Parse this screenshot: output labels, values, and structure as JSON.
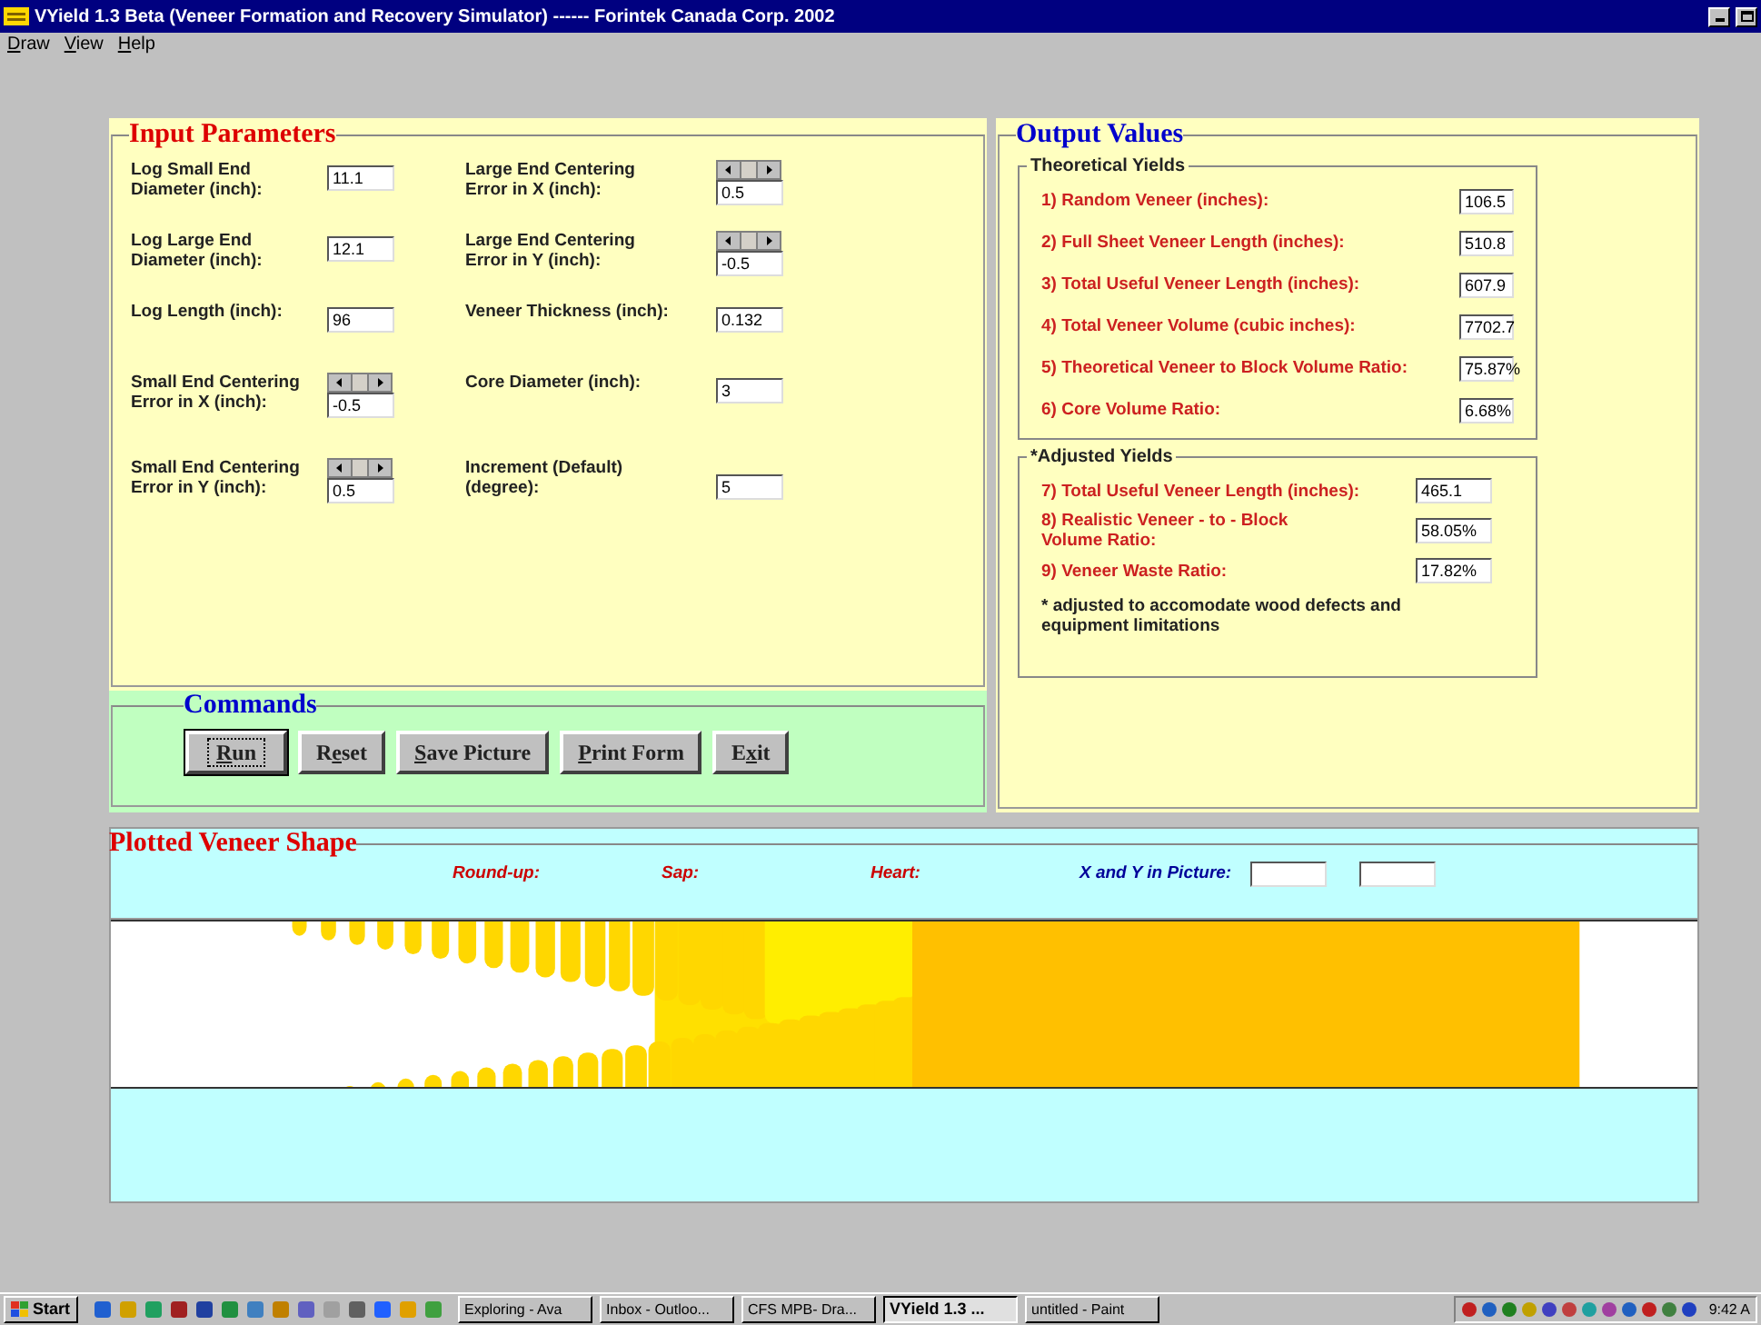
{
  "window": {
    "title": "VYield 1.3 Beta (Veneer Formation and Recovery Simulator) ------ Forintek Canada Corp. 2002"
  },
  "menu": [
    {
      "key": "D",
      "rest": "raw"
    },
    {
      "key": "V",
      "rest": "iew"
    },
    {
      "key": "H",
      "rest": "elp"
    }
  ],
  "input_parameters": {
    "title": "Input Parameters",
    "fields": [
      {
        "label": "Log Small End Diameter (inch):",
        "value": "11.1",
        "kind": "text"
      },
      {
        "label": "Large End Centering Error in X (inch):",
        "value": "0.5",
        "kind": "spin"
      },
      {
        "label": "Log Large End Diameter (inch):",
        "value": "12.1",
        "kind": "text"
      },
      {
        "label": "Large End Centering Error in Y (inch):",
        "value": "-0.5",
        "kind": "spin"
      },
      {
        "label": "Log Length (inch):",
        "value": "96",
        "kind": "text"
      },
      {
        "label": "Veneer Thickness (inch):",
        "value": "0.132",
        "kind": "text"
      },
      {
        "label": "Small End Centering Error in X (inch):",
        "value": "-0.5",
        "kind": "spin"
      },
      {
        "label": "Core Diameter (inch):",
        "value": "3",
        "kind": "text"
      },
      {
        "label": "Small End Centering Error in Y (inch):",
        "value": "0.5",
        "kind": "spin"
      },
      {
        "label": "Increment (Default) (degree):",
        "value": "5",
        "kind": "text"
      }
    ]
  },
  "commands": {
    "title": "Commands",
    "buttons": [
      {
        "key": "R",
        "post": "un",
        "focused": true
      },
      {
        "pre": "R",
        "key": "e",
        "post": "set",
        "focused": false
      },
      {
        "key": "S",
        "post": "ave Picture",
        "focused": false
      },
      {
        "key": "P",
        "post": "rint Form",
        "focused": false
      },
      {
        "pre": "E",
        "key": "x",
        "post": "it",
        "focused": false
      }
    ]
  },
  "output_values": {
    "title": "Output Values",
    "theoretical": {
      "title": "Theoretical Yields",
      "rows": [
        {
          "label": "1) Random Veneer (inches):",
          "value": "106.5"
        },
        {
          "label": "2) Full Sheet Veneer Length (inches):",
          "value": "510.8"
        },
        {
          "label": "3) Total Useful Veneer Length (inches):",
          "value": "607.9"
        },
        {
          "label": "4) Total Veneer Volume (cubic inches):",
          "value": "7702.7"
        },
        {
          "label": "5) Theoretical Veneer to Block Volume Ratio:",
          "value": "75.87%"
        },
        {
          "label": "6) Core Volume Ratio:",
          "value": "6.68%"
        }
      ]
    },
    "adjusted": {
      "title": "*Adjusted Yields",
      "rows": [
        {
          "label": "7) Total Useful Veneer Length (inches):",
          "value": "465.1"
        },
        {
          "label": "8) Realistic Veneer - to - Block Volume Ratio:",
          "value": "58.05%"
        },
        {
          "label": "9) Veneer Waste Ratio:",
          "value": "17.82%"
        }
      ],
      "note": "* adjusted to accomodate wood defects and equipment limitations"
    }
  },
  "plot": {
    "title": "Plotted Veneer Shape",
    "legend": [
      {
        "label": "Round-up:",
        "color": "#cc0000"
      },
      {
        "label": "Sap:",
        "color": "#cc0000"
      },
      {
        "label": "Heart:",
        "color": "#cc0000"
      },
      {
        "label": "X and Y in Picture:",
        "color": "#000099"
      }
    ]
  },
  "taskbar": {
    "start": "Start",
    "tasks": [
      {
        "label": "Exploring - Ava",
        "selected": false
      },
      {
        "label": "Inbox - Outloo...",
        "selected": false
      },
      {
        "label": "CFS MPB- Dra...",
        "selected": false
      },
      {
        "label": "VYield 1.3 ...",
        "selected": true
      },
      {
        "label": "untitled - Paint",
        "selected": false
      }
    ],
    "clock": "9:42 A"
  }
}
